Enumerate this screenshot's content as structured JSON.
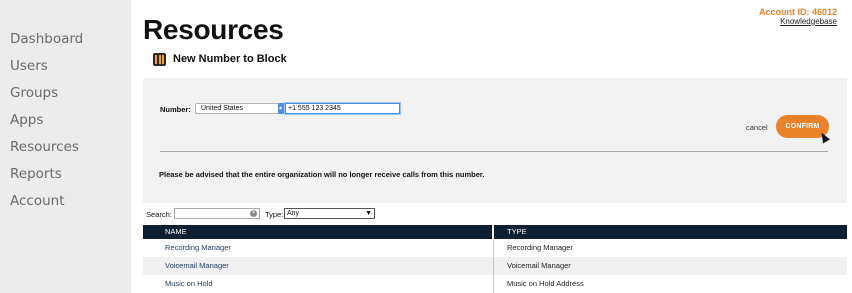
{
  "sidebar": {
    "items": [
      {
        "label": "Dashboard"
      },
      {
        "label": "Users"
      },
      {
        "label": "Groups"
      },
      {
        "label": "Apps"
      },
      {
        "label": "Resources"
      },
      {
        "label": "Reports"
      },
      {
        "label": "Account"
      }
    ]
  },
  "header": {
    "title": "Resources",
    "account_id": "Account ID: 46012",
    "knowledgebase": "Knowledgebase"
  },
  "subheader": {
    "title": "New Number to Block",
    "icon": "app-icon"
  },
  "form": {
    "number_label": "Number:",
    "country_value": "United States",
    "phone_value": "+1 555 123 2345",
    "cancel_label": "cancel",
    "confirm_label": "CONFIRM",
    "advisory": "Please be advised that the entire organization will no longer receive calls from this number."
  },
  "filters": {
    "search_label": "Search:",
    "search_value": "",
    "type_label": "Type:",
    "type_value": "Any"
  },
  "table": {
    "columns": [
      "NAME",
      "TYPE"
    ],
    "rows": [
      {
        "name": "Recording Manager",
        "type": "Recording Manager"
      },
      {
        "name": "Voicemail Manager",
        "type": "Voicemail Manager"
      },
      {
        "name": "Music on Hold",
        "type": "Music on Hold Address"
      }
    ]
  },
  "colors": {
    "accent": "#e8832a",
    "table_header": "#0d1f33",
    "sidebar_bg": "#ececec"
  }
}
